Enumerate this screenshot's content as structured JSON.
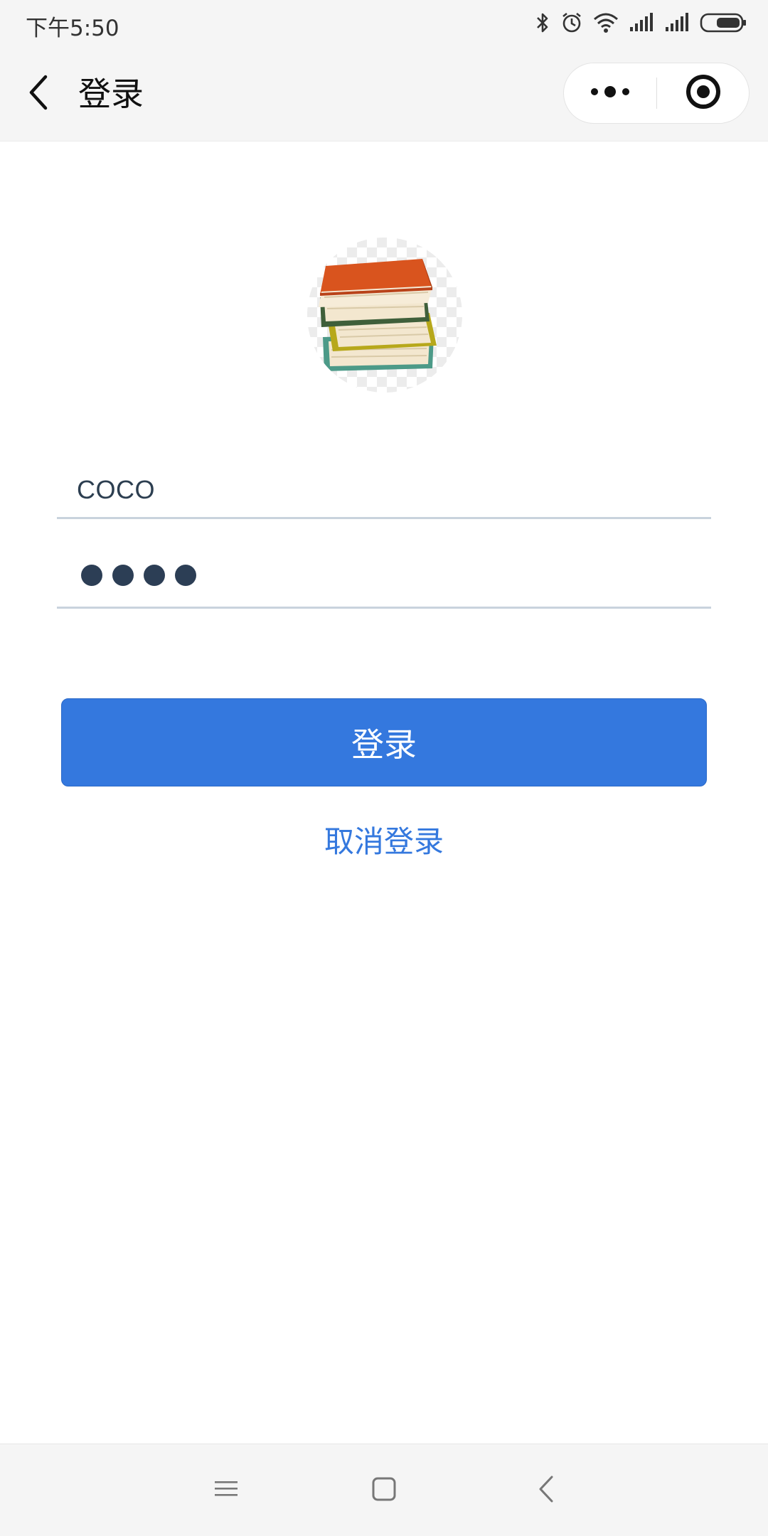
{
  "status_bar": {
    "time": "下午5:50",
    "icons": [
      "bluetooth-icon",
      "alarm-icon",
      "wifi-icon",
      "signal-icon",
      "signal-icon",
      "battery-icon"
    ]
  },
  "nav_bar": {
    "title": "登录",
    "back_icon": "chevron-left-icon",
    "more_icon": "more-dots-icon",
    "close_icon": "target-circle-icon"
  },
  "avatar": {
    "icon": "books-stack-image"
  },
  "form": {
    "username_value": "COCO",
    "password_masked_length": 4
  },
  "buttons": {
    "login_label": "登录",
    "cancel_label": "取消登录"
  },
  "system_nav": {
    "icons": [
      "menu-icon",
      "home-square-icon",
      "back-chevron-icon"
    ]
  },
  "colors": {
    "primary": "#3478de",
    "bar_background": "#f5f5f5",
    "input_text": "#2c3e50",
    "underline": "#c9d3dd"
  }
}
